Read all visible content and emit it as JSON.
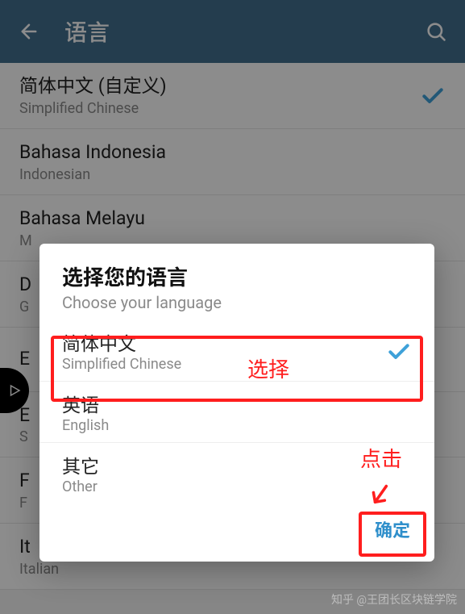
{
  "header": {
    "title": "语言"
  },
  "languages": [
    {
      "primary": "简体中文 (自定义)",
      "secondary": "Simplified Chinese",
      "selected": true
    },
    {
      "primary": "Bahasa Indonesia",
      "secondary": "Indonesian",
      "selected": false
    },
    {
      "primary": "Bahasa Melayu",
      "secondary": "M",
      "selected": false
    },
    {
      "primary": "D",
      "secondary": "G",
      "selected": false
    },
    {
      "primary": "E",
      "secondary": "",
      "selected": false
    },
    {
      "primary": "E",
      "secondary": "S",
      "selected": false
    },
    {
      "primary": "F",
      "secondary": "F",
      "selected": false
    },
    {
      "primary": "It",
      "secondary": "Italian",
      "selected": false
    }
  ],
  "dialog": {
    "title": "选择您的语言",
    "subtitle": "Choose your language",
    "options": [
      {
        "primary": "简体中文",
        "secondary": "Simplified Chinese",
        "selected": true
      },
      {
        "primary": "英语",
        "secondary": "English",
        "selected": false
      },
      {
        "primary": "其它",
        "secondary": "Other",
        "selected": false
      }
    ],
    "confirm": "确定"
  },
  "annotations": {
    "select": "选择",
    "click": "点击"
  },
  "watermark": "知乎 @王团长区块链学院"
}
